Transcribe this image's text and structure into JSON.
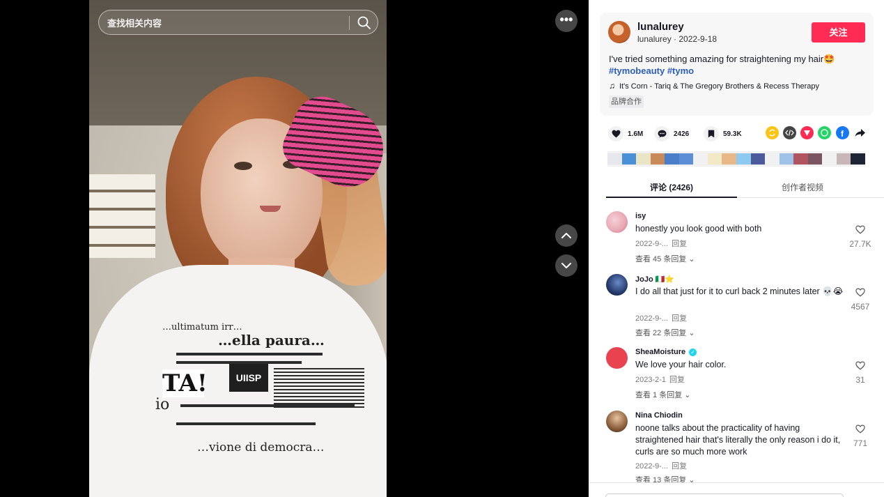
{
  "search": {
    "placeholder": "查找相关内容",
    "icon": "search-icon"
  },
  "video": {
    "more_label": "•••",
    "nav": [
      "chevron-up-icon",
      "chevron-down-icon"
    ]
  },
  "author": {
    "name": "lunalurey",
    "meta": "lunalurey · 2022-9-18",
    "follow_label": "关注"
  },
  "post": {
    "description": "I've tried something amazing for straightening my hair🤩",
    "hashtags": [
      "#tymobeauty",
      "#tymo"
    ],
    "music": "It's Corn - Tariq & The Gregory Brothers & Recess Therapy",
    "brand_tag": "品牌合作"
  },
  "stats": {
    "likes": "1.6M",
    "comments": "2426",
    "saves": "59.3K"
  },
  "share_icons": [
    {
      "name": "repost-icon",
      "color": "#fcc419"
    },
    {
      "name": "embed-icon",
      "color": "#444444"
    },
    {
      "name": "send-icon",
      "color": "#fe2c55"
    },
    {
      "name": "whatsapp-icon",
      "color": "#25d366"
    },
    {
      "name": "facebook-icon",
      "color": "#1877f2"
    },
    {
      "name": "share-arrow-icon",
      "color": "#161823"
    }
  ],
  "embed_colors": [
    "#e6e7ea",
    "#4a90d9",
    "#eae6c5",
    "#c98a5a",
    "#4a7ec9",
    "#5b8ed6",
    "#f1f1f2",
    "#f2e9c6",
    "#e9b888",
    "#8ecaf0",
    "#4a5a9a",
    "#f1f1f2",
    "#9fc3e8",
    "#b0555f",
    "#7a5560",
    "#f1f1f2",
    "#c8b6b8",
    "#1d2433"
  ],
  "tabs": [
    {
      "label": "评论 (2426)",
      "active": true
    },
    {
      "label": "创作者视频",
      "active": false
    }
  ],
  "comments": [
    {
      "user": "isy",
      "text": "honestly you look good with both",
      "date": "2022-9-...",
      "reply": "回复",
      "replies": "查看 45 条回复",
      "likes": "27.7K",
      "avatar_color": "#e8a7b3"
    },
    {
      "user": "JoJo 🇮🇹⭐",
      "text": "I do all that just for it to curl back 2 minutes later 💀😭",
      "date": "2022-9-...",
      "reply": "回复",
      "replies": "查看 22 条回复",
      "likes": "4567",
      "avatar_color": "#243a6b"
    },
    {
      "user": "SheaMoisture",
      "verified": true,
      "text": "We love your hair color.",
      "date": "2023-2-1",
      "reply": "回复",
      "replies": "查看 1 条回复",
      "likes": "31",
      "avatar_color": "#e9434f"
    },
    {
      "user": "Nina Chiodin",
      "text": "noone talks about the practicality of having straightened hair that's literally the only reason i do it, curls are so much more work",
      "date": "2022-9-...",
      "reply": "回复",
      "replies": "查看 13 条回复",
      "likes": "771",
      "avatar_color": "#8b5e3c"
    }
  ]
}
